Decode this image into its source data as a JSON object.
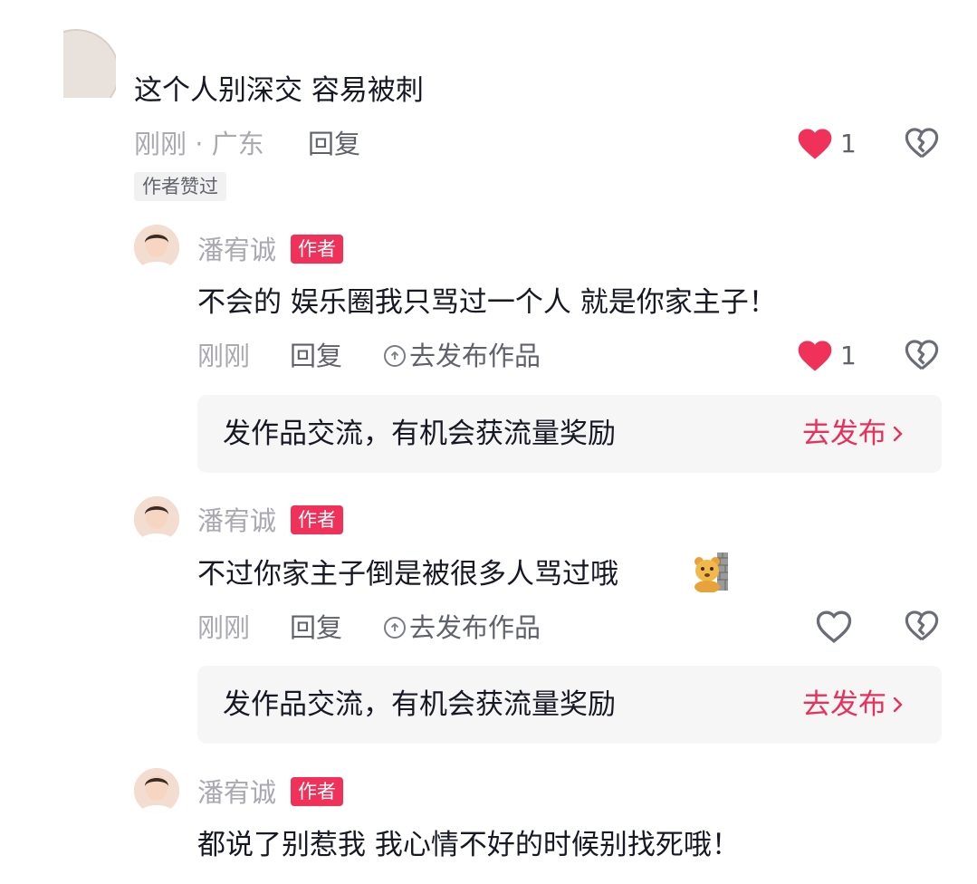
{
  "top_comment": {
    "text": "这个人别深交 容易被刺",
    "time_location": "刚刚 · 广东",
    "reply_label": "回复",
    "like_count": "1",
    "liked": true,
    "liked_by_author_tag": "作者赞过"
  },
  "replies": [
    {
      "author": "潘宥诚",
      "badge": "作者",
      "text": "不会的 娱乐圈我只骂过一个人 就是你家主子！",
      "time": "刚刚",
      "reply_label": "回复",
      "publish_label": "去发布作品",
      "like_count": "1",
      "liked": true,
      "prompt": {
        "text": "发作品交流，有机会获流量奖励",
        "action": "去发布"
      }
    },
    {
      "author": "潘宥诚",
      "badge": "作者",
      "text": "不过你家主子倒是被很多人骂过哦",
      "time": "刚刚",
      "reply_label": "回复",
      "publish_label": "去发布作品",
      "like_count": "",
      "liked": false,
      "prompt": {
        "text": "发作品交流，有机会获流量奖励",
        "action": "去发布"
      }
    },
    {
      "author": "潘宥诚",
      "badge": "作者",
      "text": "都说了别惹我 我心情不好的时候别找死哦！"
    }
  ],
  "colors": {
    "accent": "#f0325a",
    "action_red": "#e8305a",
    "muted_text": "#a9a9b0",
    "prompt_bg": "#f6f6f7"
  },
  "icons": [
    "heart-icon",
    "broken-heart-icon",
    "upload-circle-icon",
    "chevron-right-icon",
    "bear-emoji-icon"
  ]
}
